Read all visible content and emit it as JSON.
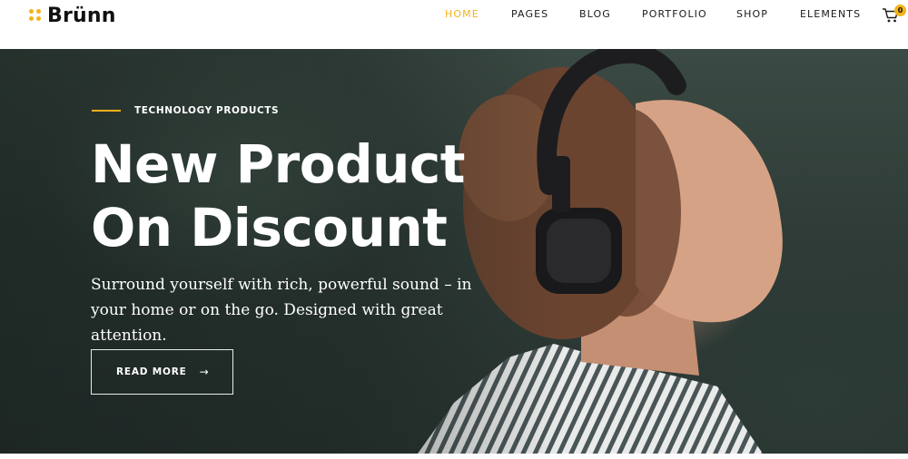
{
  "colors": {
    "accent": "#f3b31b",
    "text_dark": "#1a1a1a",
    "white": "#ffffff"
  },
  "header": {
    "logo_text": "Brünn",
    "nav": [
      {
        "label": "HOME",
        "active": true
      },
      {
        "label": "PAGES",
        "active": false
      },
      {
        "label": "BLOG",
        "active": false
      },
      {
        "label": "PORTFOLIO",
        "active": false
      },
      {
        "label": "SHOP",
        "active": false
      },
      {
        "label": "ELEMENTS",
        "active": false
      }
    ],
    "cart_icon": "cart-icon",
    "cart_count": "0"
  },
  "hero": {
    "eyebrow": "TECHNOLOGY PRODUCTS",
    "headline_line1": "New Product",
    "headline_line2": "On Discount",
    "subtext": "Surround yourself with rich, powerful sound – in your home or on the go. Designed with great attention.",
    "cta_label": "READ MORE",
    "cta_icon": "arrow-right-icon"
  }
}
